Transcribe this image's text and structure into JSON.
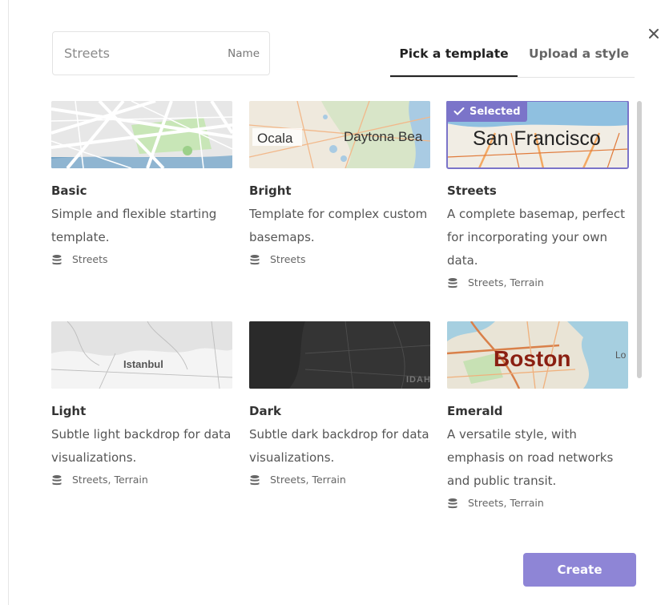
{
  "dialog": {
    "close_icon": "close-icon",
    "name_field": {
      "placeholder": "Streets",
      "value": "",
      "suffix_label": "Name"
    },
    "tabs": [
      {
        "label": "Pick a template",
        "active": true
      },
      {
        "label": "Upload a style",
        "active": false
      }
    ],
    "templates": [
      {
        "title": "Basic",
        "description": "Simple and flexible starting template.",
        "sources": "Streets",
        "selected": false,
        "thumb_label": ""
      },
      {
        "title": "Bright",
        "description": "Template for complex custom basemaps.",
        "sources": "Streets",
        "selected": false,
        "thumb_label": "Ocala",
        "thumb_label2": "Daytona Bea"
      },
      {
        "title": "Streets",
        "description": "A complete basemap, perfect for incorporating your own data.",
        "sources": "Streets, Terrain",
        "selected": true,
        "thumb_label": "San Francisco"
      },
      {
        "title": "Light",
        "description": "Subtle light backdrop for data visualizations.",
        "sources": "Streets, Terrain",
        "selected": false,
        "thumb_label": "Istanbul"
      },
      {
        "title": "Dark",
        "description": "Subtle dark backdrop for data visualizations.",
        "sources": "Streets, Terrain",
        "selected": false,
        "thumb_label": "IDAH"
      },
      {
        "title": "Emerald",
        "description": "A versatile style, with emphasis on road networks and public transit.",
        "sources": "Streets, Terrain",
        "selected": false,
        "thumb_label": "Boston",
        "thumb_label2": "Lo"
      }
    ],
    "selected_badge_label": "Selected",
    "create_label": "Create",
    "colors": {
      "accent": "#7b74c9",
      "create_button": "#8e85d6"
    }
  }
}
